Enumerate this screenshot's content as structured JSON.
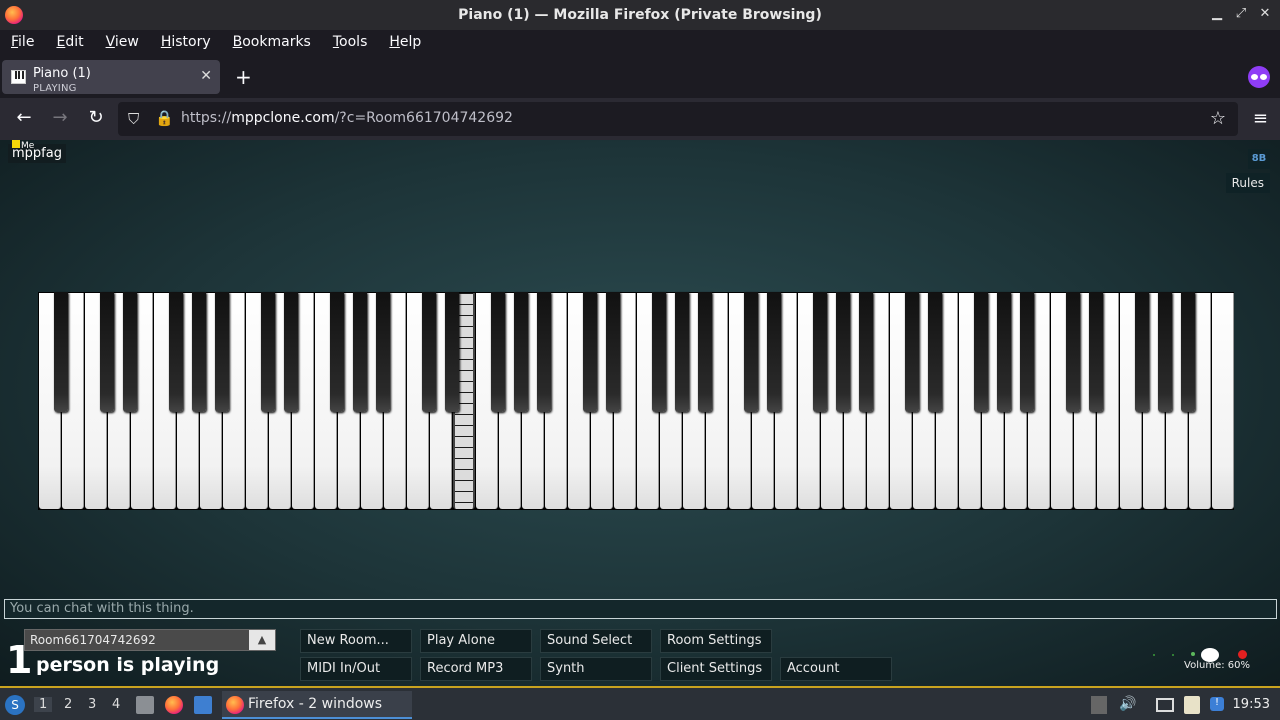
{
  "window": {
    "title": "Piano (1) — Mozilla Firefox (Private Browsing)",
    "minimize": "▁",
    "restore": "⤢",
    "close": "✕"
  },
  "menu": [
    "File",
    "Edit",
    "View",
    "History",
    "Bookmarks",
    "Tools",
    "Help"
  ],
  "tab": {
    "title": "Piano (1)",
    "subtitle": "PLAYING",
    "close": "✕",
    "new_tab": "+"
  },
  "nav": {
    "back": "←",
    "forward": "→",
    "reload": "↻",
    "url_prefix": "https://",
    "url_host": "mppclone.com",
    "url_path": "/?c=Room661704742692",
    "bookmark": "☆",
    "menu": "≡",
    "shield": "⛉",
    "lock": "🔒"
  },
  "page": {
    "me_label": "Me",
    "user_name": "mppfag",
    "rules_icon": "8B",
    "rules_label": "Rules",
    "chat_placeholder": "You can chat with this thing.",
    "room_name": "Room661704742692",
    "room_arrow": "▲",
    "player_count": "1",
    "player_text": "person is playing",
    "buttons_row1": [
      "New Room...",
      "Play Alone",
      "Sound Select",
      "Room Settings"
    ],
    "buttons_row2": [
      "MIDI In/Out",
      "Record MP3",
      "Synth",
      "Client Settings",
      "Account"
    ],
    "volume_label": "Volume: 60%",
    "volume_level": 0.6,
    "piano": {
      "white_keys": 52,
      "pressed_key": 18
    }
  },
  "taskbar": {
    "start_icon": "S",
    "workspaces": [
      "1",
      "2",
      "3",
      "4"
    ],
    "active_workspace": "1",
    "app_label": "Firefox - 2 windows",
    "clock": "19:53"
  },
  "colors": {
    "accent": "#8f3df6",
    "taskbar_border": "#c9a31f"
  }
}
